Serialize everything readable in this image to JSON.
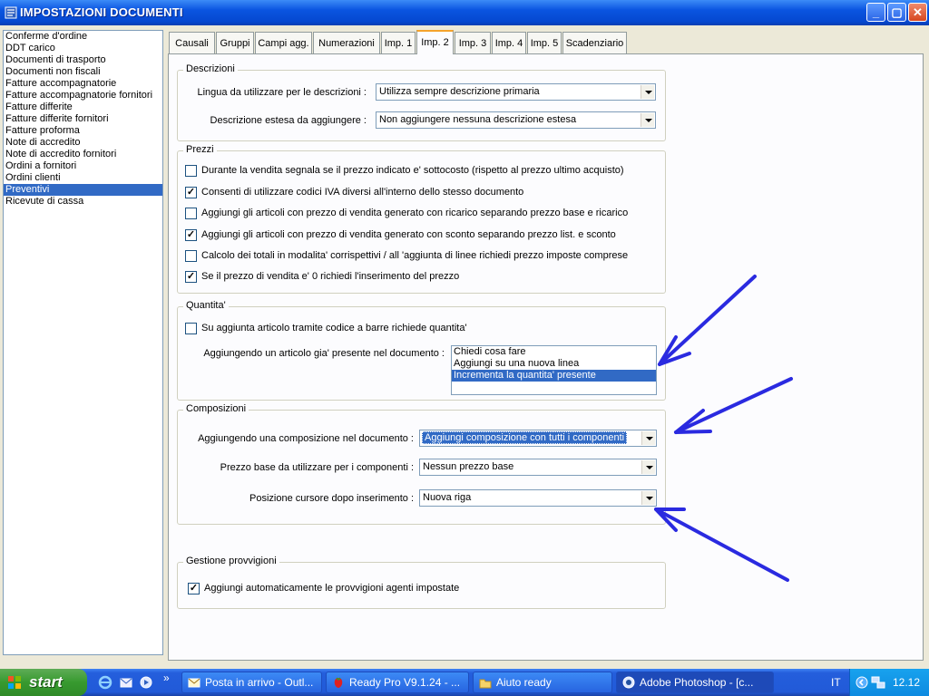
{
  "window": {
    "title": "IMPOSTAZIONI DOCUMENTI",
    "minimize": "_",
    "maximize": "▢",
    "close": "✕"
  },
  "doc_types": [
    "Conferme d'ordine",
    "DDT carico",
    "Documenti di trasporto",
    "Documenti non fiscali",
    "Fatture accompagnatorie",
    "Fatture accompagnatorie fornitori",
    "Fatture differite",
    "Fatture differite fornitori",
    "Fatture proforma",
    "Note di accredito",
    "Note di accredito fornitori",
    "Ordini a fornitori",
    "Ordini clienti",
    "Preventivi",
    "Ricevute di cassa"
  ],
  "selected_doc_type": "Preventivi",
  "tabs": [
    "Causali",
    "Gruppi",
    "Campi agg.",
    "Numerazioni",
    "Imp. 1",
    "Imp. 2",
    "Imp. 3",
    "Imp. 4",
    "Imp. 5",
    "Scadenziario"
  ],
  "active_tab": "Imp. 2",
  "descrizioni": {
    "title": "Descrizioni",
    "lingua_label": "Lingua da utilizzare per le descrizioni :",
    "lingua_value": "Utilizza sempre descrizione primaria",
    "estesa_label": "Descrizione estesa da aggiungere :",
    "estesa_value": "Non aggiungere nessuna descrizione estesa"
  },
  "prezzi": {
    "title": "Prezzi",
    "options": [
      {
        "label": "Durante la vendita segnala se il prezzo indicato e' sottocosto (rispetto al prezzo ultimo acquisto)",
        "checked": false
      },
      {
        "label": "Consenti di utilizzare codici IVA diversi all'interno dello stesso documento",
        "checked": true
      },
      {
        "label": "Aggiungi gli articoli con prezzo di vendita generato con ricarico separando prezzo base e ricarico",
        "checked": false
      },
      {
        "label": "Aggiungi gli articoli con prezzo di vendita generato con sconto separando prezzo list. e sconto",
        "checked": true
      },
      {
        "label": "Calcolo dei totali in modalita' corrispettivi / all 'aggiunta di linee richiedi prezzo imposte comprese",
        "checked": false
      },
      {
        "label": "Se il prezzo di vendita e' 0 richiedi l'inserimento del prezzo",
        "checked": true
      }
    ]
  },
  "quantita": {
    "title": "Quantita'",
    "barcode_label": "Su aggiunta articolo tramite codice a barre richiede quantita'",
    "barcode_checked": false,
    "presente_label": "Aggiungendo un articolo gia' presente nel documento :",
    "presente_options": [
      "Chiedi cosa fare",
      "Aggiungi su una nuova linea",
      "Incrementa la quantita' presente"
    ],
    "presente_selected": 2
  },
  "composizioni": {
    "title": "Composizioni",
    "aggiungendo_label": "Aggiungendo una composizione nel documento :",
    "aggiungendo_value": "Aggiungi composizione con tutti i componenti",
    "prezzo_label": "Prezzo base da utilizzare per i componenti :",
    "prezzo_value": "Nessun prezzo base",
    "cursore_label": "Posizione cursore dopo inserimento :",
    "cursore_value": "Nuova riga"
  },
  "provvigioni": {
    "title": "Gestione provvigioni",
    "auto_label": "Aggiungi automaticamente le provvigioni agenti impostate",
    "auto_checked": true
  },
  "annotation_color": "#2a2ae0",
  "taskbar": {
    "start_label": "start",
    "buttons": [
      {
        "label": "Posta in arrivo - Outl...",
        "icon": "envelope-icon"
      },
      {
        "label": "Ready Pro V9.1.24 - ...",
        "icon": "strawberry-icon"
      },
      {
        "label": "Aiuto ready",
        "icon": "folder-icon"
      },
      {
        "label": "Adobe Photoshop - [c...",
        "icon": "photoshop-icon"
      }
    ],
    "quicklaunch_more": "»",
    "language": "IT",
    "time": "12.12"
  }
}
